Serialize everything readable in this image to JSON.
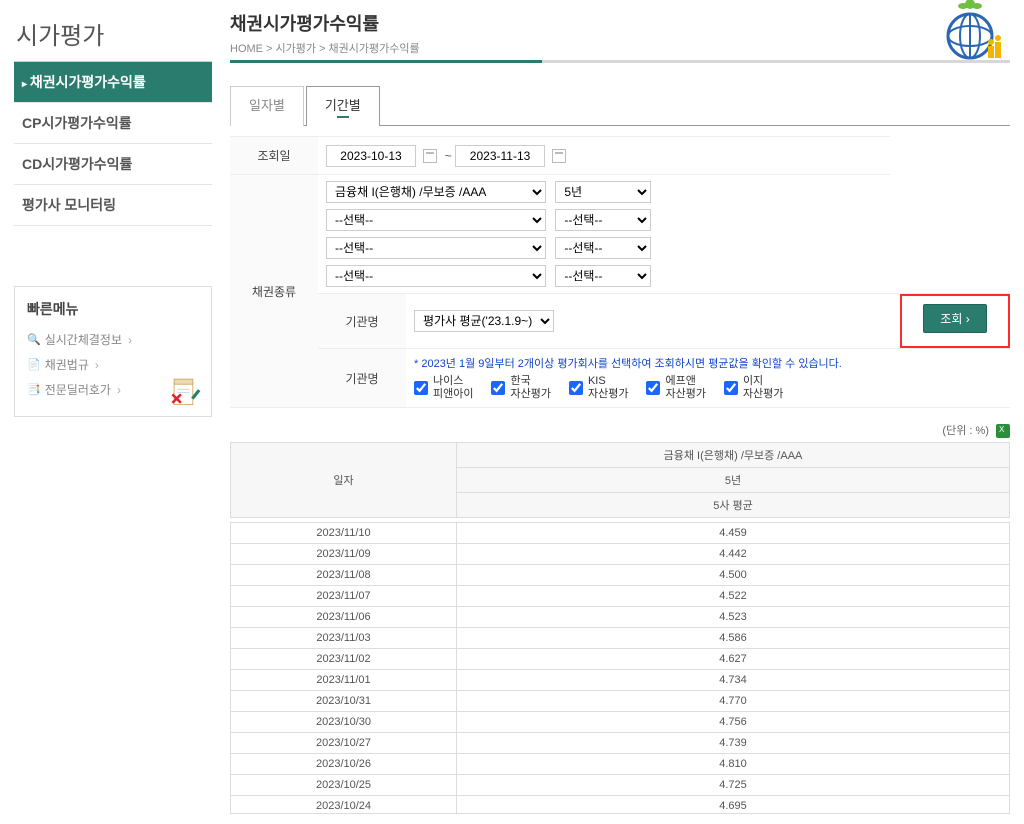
{
  "sidebar": {
    "title": "시가평가",
    "items": [
      {
        "label": "채권시가평가수익률",
        "active": true
      },
      {
        "label": "CP시가평가수익률",
        "active": false
      },
      {
        "label": "CD시가평가수익률",
        "active": false
      },
      {
        "label": "평가사 모니터링",
        "active": false
      }
    ]
  },
  "quick": {
    "title": "빠른메뉴",
    "items": [
      {
        "icon": "🔍",
        "label": "실시간체결정보"
      },
      {
        "icon": "📄",
        "label": "채권법규"
      },
      {
        "icon": "📑",
        "label": "전문딜러호가"
      }
    ]
  },
  "header": {
    "title": "채권시가평가수익률",
    "breadcrumb": "HOME > 시가평가 > 채권시가평가수익률"
  },
  "tabs": [
    {
      "label": "일자별",
      "active": false
    },
    {
      "label": "기간별",
      "active": true
    }
  ],
  "filters": {
    "row1_label": "조회일",
    "date_from": "2023-10-13",
    "date_sep": "~",
    "date_to": "2023-11-13",
    "row2_label": "채권종류",
    "bondtype_selected": "금융채 I(은행채) /무보증 /AAA",
    "term_selected": "5년",
    "placeholder_select": "--선택--",
    "row3_label": "기관명",
    "org_selected": "평가사 평균('23.1.9~)",
    "search_btn": "조회",
    "row4_label": "기관명",
    "notice": "* 2023년 1월 9일부터 2개이상 평가회사를 선택하여 조회하시면 평균값을 확인할 수 있습니다.",
    "checks": [
      {
        "l1": "나이스",
        "l2": "피앤아이"
      },
      {
        "l1": "한국",
        "l2": "자산평가"
      },
      {
        "l1": "KIS",
        "l2": "자산평가"
      },
      {
        "l1": "에프앤",
        "l2": "자산평가"
      },
      {
        "l1": "이지",
        "l2": "자산평가"
      }
    ]
  },
  "unit": "(단위 : %)",
  "table": {
    "col_date": "일자",
    "col_top": "금융채 I(은행채) /무보증 /AAA",
    "col_mid": "5년",
    "col_bot": "5사 평균",
    "rows": [
      {
        "date": "2023/11/10",
        "val": "4.459"
      },
      {
        "date": "2023/11/09",
        "val": "4.442"
      },
      {
        "date": "2023/11/08",
        "val": "4.500"
      },
      {
        "date": "2023/11/07",
        "val": "4.522"
      },
      {
        "date": "2023/11/06",
        "val": "4.523"
      },
      {
        "date": "2023/11/03",
        "val": "4.586"
      },
      {
        "date": "2023/11/02",
        "val": "4.627"
      },
      {
        "date": "2023/11/01",
        "val": "4.734"
      },
      {
        "date": "2023/10/31",
        "val": "4.770"
      },
      {
        "date": "2023/10/30",
        "val": "4.756"
      },
      {
        "date": "2023/10/27",
        "val": "4.739"
      },
      {
        "date": "2023/10/26",
        "val": "4.810"
      },
      {
        "date": "2023/10/25",
        "val": "4.725"
      },
      {
        "date": "2023/10/24",
        "val": "4.695"
      }
    ]
  }
}
